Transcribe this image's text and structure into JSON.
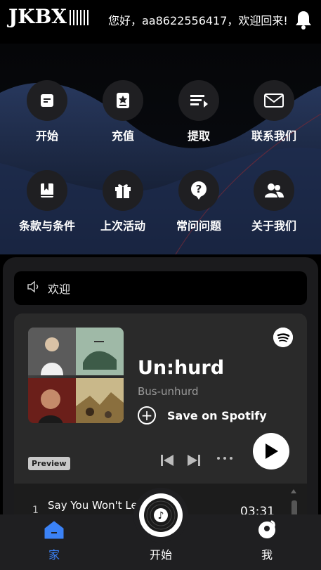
{
  "header": {
    "logo_text": "JKBX",
    "greeting": "您好，aa8622556417，欢迎回来!",
    "icons": {
      "bell": "bell-icon"
    }
  },
  "menu": {
    "items": [
      {
        "label": "开始",
        "icon": "file-icon"
      },
      {
        "label": "充值",
        "icon": "deposit-icon"
      },
      {
        "label": "提取",
        "icon": "withdraw-icon"
      },
      {
        "label": "联系我们",
        "icon": "mail-icon"
      },
      {
        "label": "条款与条件",
        "icon": "bookmark-book-icon"
      },
      {
        "label": "上次活动",
        "icon": "gift-icon"
      },
      {
        "label": "常问问题",
        "icon": "question-icon"
      },
      {
        "label": "关于我们",
        "icon": "users-icon"
      }
    ]
  },
  "announcement": {
    "text": "欢迎",
    "icon": "speaker-icon"
  },
  "player": {
    "title": "Un:hurd",
    "artist": "Bus-unhurd",
    "save_label": "Save on Spotify",
    "preview_label": "Preview",
    "tracks": [
      {
        "number": "1",
        "title": "Say You Won't Le",
        "duration": "03:31"
      }
    ]
  },
  "bottom_nav": {
    "items": [
      {
        "label": "家",
        "icon": "home-icon",
        "active": true
      },
      {
        "label": "开始",
        "icon": "vinyl-music-icon",
        "active": false
      },
      {
        "label": "我",
        "icon": "profile-icon",
        "active": false
      }
    ]
  },
  "colors": {
    "background": "#000000",
    "wave_blue": "#1c2a4a",
    "card": "#2a2a2a",
    "nav_active": "#3b82f6",
    "nav_bar": "#1f1f21"
  }
}
